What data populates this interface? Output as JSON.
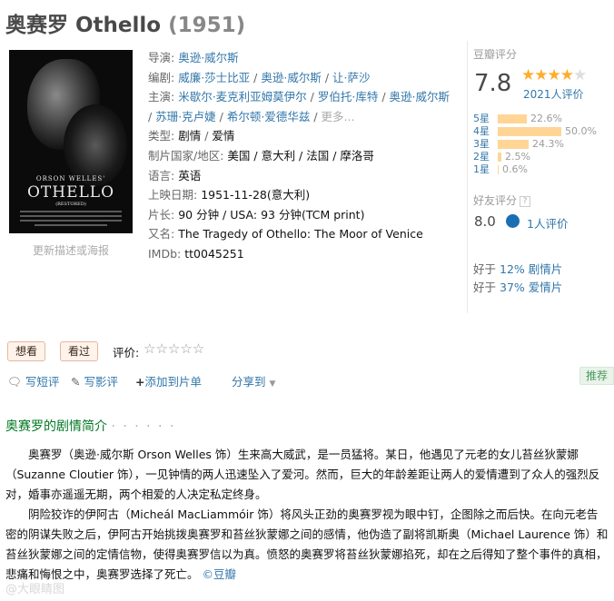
{
  "title": {
    "name": "奥赛罗 Othello",
    "year": "(1951)"
  },
  "poster": {
    "line1": "ORSON WELLES'",
    "line2": "OTHELLO",
    "line3": "(RESTORED)",
    "change_link": "更新描述或海报"
  },
  "info": {
    "director_label": "导演:",
    "director": [
      "奥逊·威尔斯"
    ],
    "writer_label": "编剧:",
    "writers": [
      "威廉·莎士比亚",
      "奥逊·威尔斯",
      "让·萨沙"
    ],
    "cast_label": "主演:",
    "cast": [
      "米歇尔·麦克利亚姆莫伊尔",
      "罗伯托·库特",
      "奥逊·威尔斯",
      "苏珊·克卢婕",
      "希尔顿·爱德华兹"
    ],
    "more": "更多...",
    "genre_label": "类型:",
    "genres": [
      "剧情",
      "爱情"
    ],
    "country_label": "制片国家/地区:",
    "country": "美国 / 意大利 / 法国 / 摩洛哥",
    "language_label": "语言:",
    "language": "英语",
    "release_label": "上映日期:",
    "release": "1951-11-28(意大利)",
    "runtime_label": "片长:",
    "runtime": "90 分钟 / USA: 93 分钟(TCM print)",
    "aka_label": "又名:",
    "aka": "The Tragedy of Othello: The Moor of Venice",
    "imdb_label": "IMDb:",
    "imdb": "tt0045251"
  },
  "rating": {
    "label": "豆瓣评分",
    "score": "7.8",
    "stars_on": "★★★★",
    "stars_off": "★",
    "votes": "2021人评价",
    "distribution": [
      {
        "label": "5星",
        "percent": 22.6,
        "text": "22.6%"
      },
      {
        "label": "4星",
        "percent": 50.0,
        "text": "50.0%"
      },
      {
        "label": "3星",
        "percent": 24.3,
        "text": "24.3%"
      },
      {
        "label": "2星",
        "percent": 2.5,
        "text": "2.5%"
      },
      {
        "label": "1星",
        "percent": 0.6,
        "text": "0.6%"
      }
    ],
    "friend_label": "好友评分",
    "friend_help": "?",
    "friend_score": "8.0",
    "friend_votes": "1人评价",
    "better_than": [
      {
        "prefix": "好于",
        "pct": "12%",
        "genre": "剧情片"
      },
      {
        "prefix": "好于",
        "pct": "37%",
        "genre": "爱情片"
      }
    ]
  },
  "actions": {
    "want": "想看",
    "seen": "看过",
    "rate_label": "评价:",
    "rate_stars": "☆☆☆☆☆",
    "short_review": "写短评",
    "review": "写影评",
    "add_list": "添加到片单",
    "share": "分享到",
    "recommend": "推荐"
  },
  "synopsis": {
    "title": "奥赛罗的剧情简介",
    "dots": "· · · · · ·",
    "p1": "奥赛罗（奥逊·威尔斯 Orson Welles 饰）生来高大威武，是一员猛将。某日，他遇见了元老的女儿苔丝狄蒙娜（Suzanne Cloutier 饰），一见钟情的两人迅速坠入了爱河。然而，巨大的年龄差距让两人的爱情遭到了众人的强烈反对，婚事亦遥遥无期，两个相爱的人决定私定终身。",
    "p2": "阴险狡诈的伊阿古（Micheál MacLiammóir 饰）将风头正劲的奥赛罗视为眼中钉，企图除之而后快。在向元老告密的阴谋失败之后，伊阿古开始挑拨奥赛罗和苔丝狄蒙娜之间的感情，他伪造了副将凯斯奥（Michael Laurence 饰）和苔丝狄蒙娜之间的定情信物，使得奥赛罗信以为真。愤怒的奥赛罗将苔丝狄蒙娜掐死，却在之后得知了整个事件的真相，悲痛和悔恨之中，奥赛罗选择了死亡。",
    "source": "©豆瓣"
  },
  "watermark": "@大眼睛图"
}
